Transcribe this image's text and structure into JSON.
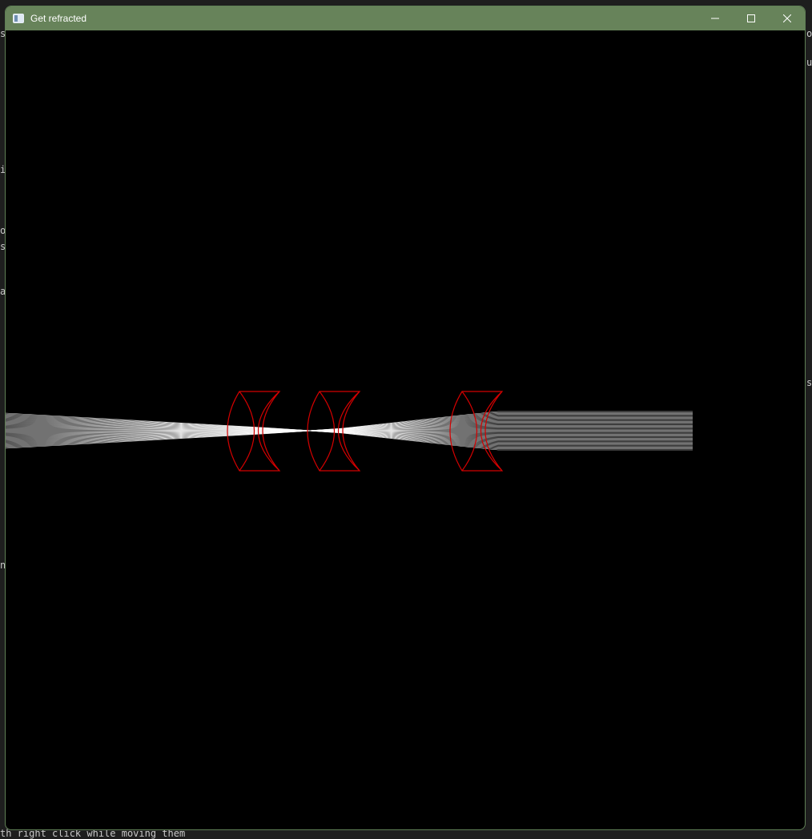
{
  "window": {
    "title": "Get refracted",
    "titlebar_color": "#67835a",
    "controls": {
      "minimize_icon": "minimize-icon",
      "maximize_icon": "maximize-icon",
      "close_icon": "close-icon"
    }
  },
  "background_terminal": {
    "bottom_text": "th right click while moving them"
  },
  "scene": {
    "background": "#000000",
    "lens_color": "#d40000",
    "ray_color": "#ffffff",
    "lens_count": 3
  }
}
